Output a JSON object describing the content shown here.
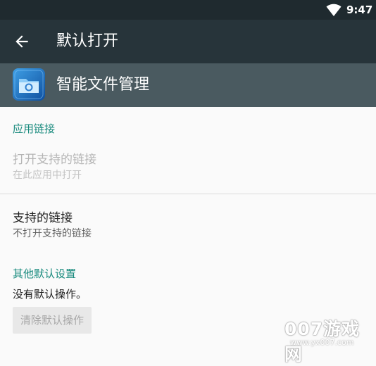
{
  "status_bar": {
    "time": "9:47",
    "icons": [
      "wifi-icon"
    ]
  },
  "toolbar": {
    "back_icon": "arrow-back-icon",
    "title": "默认打开"
  },
  "app_header": {
    "icon": "file-manager-app-icon",
    "app_name": "智能文件管理"
  },
  "sections": {
    "app_links": {
      "title": "应用链接",
      "open_supported": {
        "title": "打开支持的链接",
        "subtitle": "在此应用中打开",
        "enabled": false
      },
      "supported_links": {
        "title": "支持的链接",
        "subtitle": "不打开支持的链接"
      }
    },
    "other_defaults": {
      "title": "其他默认设置",
      "description": "没有默认操作。",
      "clear_button_label": "清除默认操作",
      "clear_button_enabled": false
    }
  },
  "watermark": {
    "main": "007游戏网",
    "sub": "www.yx007.com"
  },
  "colors": {
    "status_bar": "#1f2a2f",
    "toolbar": "#27343a",
    "app_header": "#4a5a60",
    "accent": "#16897c",
    "background": "#fafafa"
  }
}
